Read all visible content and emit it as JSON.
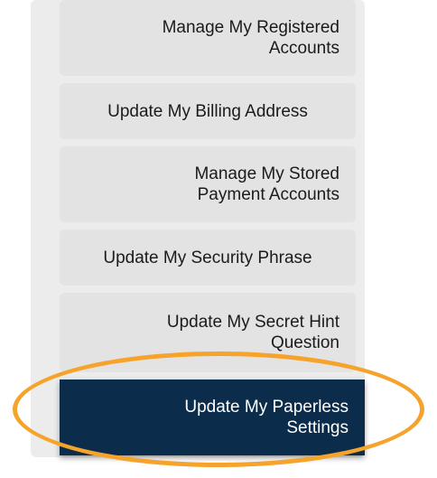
{
  "menu": {
    "items": [
      {
        "label_line1": "Manage My Registered",
        "label_line2": "Accounts"
      },
      {
        "label_line1": "Update My Billing Address",
        "label_line2": ""
      },
      {
        "label_line1": "Manage My Stored",
        "label_line2": "Payment Accounts"
      },
      {
        "label_line1": "Update My Security Phrase",
        "label_line2": ""
      },
      {
        "label_line1": "Update My Secret Hint",
        "label_line2": "Question"
      },
      {
        "label_line1": "Update My Paperless",
        "label_line2": "Settings"
      }
    ],
    "active_index": 5
  },
  "colors": {
    "item_background": "#e3e3e3",
    "active_background": "#0b2c4a",
    "active_text": "#ffffff",
    "highlight_ring": "#f5a32b"
  },
  "highlight": {
    "icon": "orange-circle-annotation"
  }
}
